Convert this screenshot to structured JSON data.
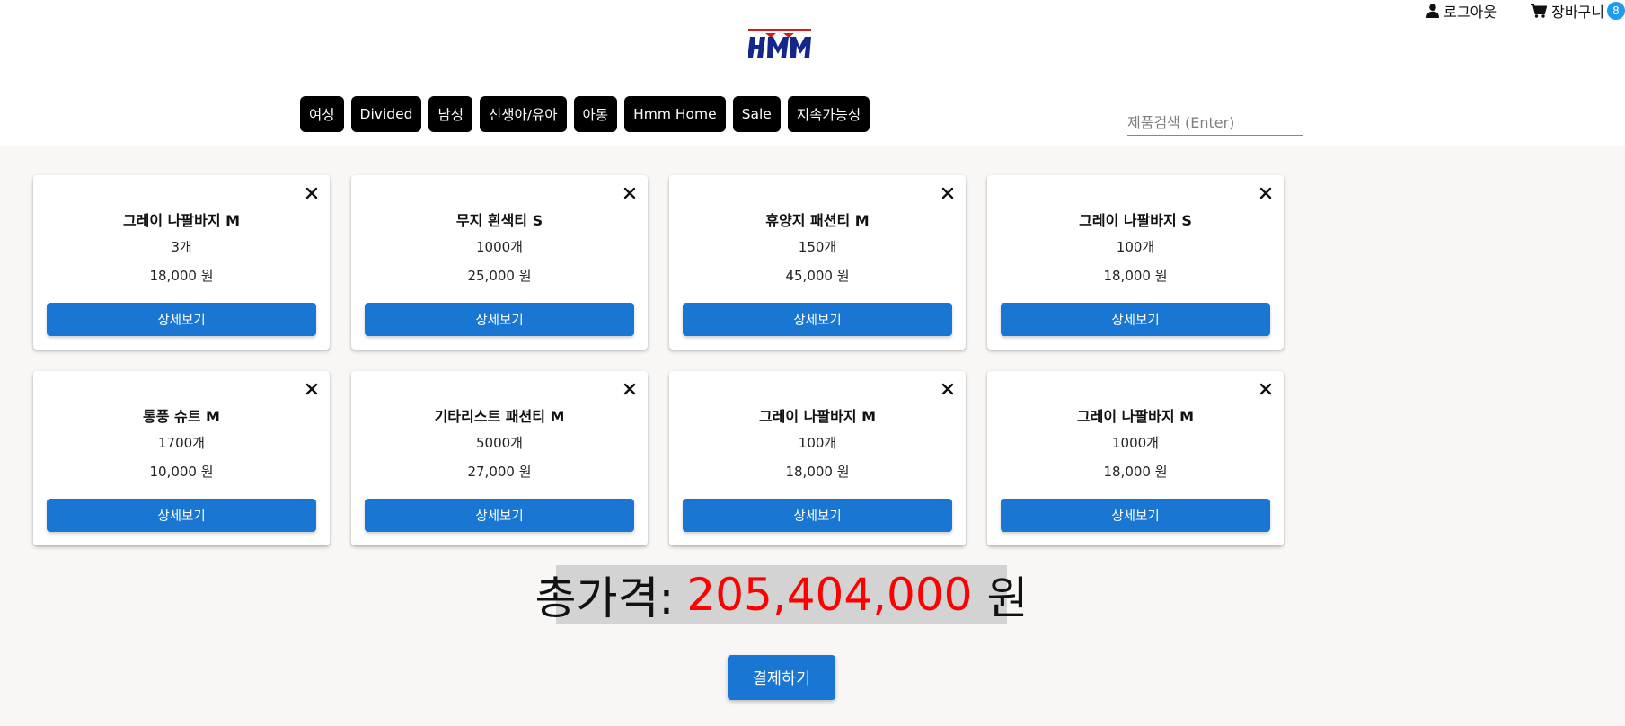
{
  "header": {
    "logout_label": "로그아웃",
    "cart_label": "장바구니",
    "cart_count": "8",
    "logo_alt": "HMM"
  },
  "nav": {
    "items": [
      "여성",
      "Divided",
      "남성",
      "신생아/유아",
      "아동",
      "Hmm Home",
      "Sale",
      "지속가능성"
    ]
  },
  "search": {
    "placeholder": "제품검색 (Enter)",
    "value": ""
  },
  "cart": {
    "items": [
      {
        "name": "그레이 나팔바지 M",
        "qty": "3개",
        "price": "18,000 원",
        "detail_label": "상세보기"
      },
      {
        "name": "무지 흰색티 S",
        "qty": "1000개",
        "price": "25,000 원",
        "detail_label": "상세보기"
      },
      {
        "name": "휴양지 패션티 M",
        "qty": "150개",
        "price": "45,000 원",
        "detail_label": "상세보기"
      },
      {
        "name": "그레이 나팔바지 S",
        "qty": "100개",
        "price": "18,000 원",
        "detail_label": "상세보기"
      },
      {
        "name": "통풍 슈트 M",
        "qty": "1700개",
        "price": "10,000 원",
        "detail_label": "상세보기"
      },
      {
        "name": "기타리스트 패션티 M",
        "qty": "5000개",
        "price": "27,000 원",
        "detail_label": "상세보기"
      },
      {
        "name": "그레이 나팔바지 M",
        "qty": "100개",
        "price": "18,000 원",
        "detail_label": "상세보기"
      },
      {
        "name": "그레이 나팔바지 M",
        "qty": "1000개",
        "price": "18,000 원",
        "detail_label": "상세보기"
      }
    ]
  },
  "total": {
    "label": "총가격:",
    "amount": "205,404,000",
    "unit": "원"
  },
  "checkout_label": "결제하기",
  "colors": {
    "primary": "#1976d2",
    "badge": "#1e9cef",
    "total_amount": "#ff0000",
    "nav_bg": "#000000"
  }
}
